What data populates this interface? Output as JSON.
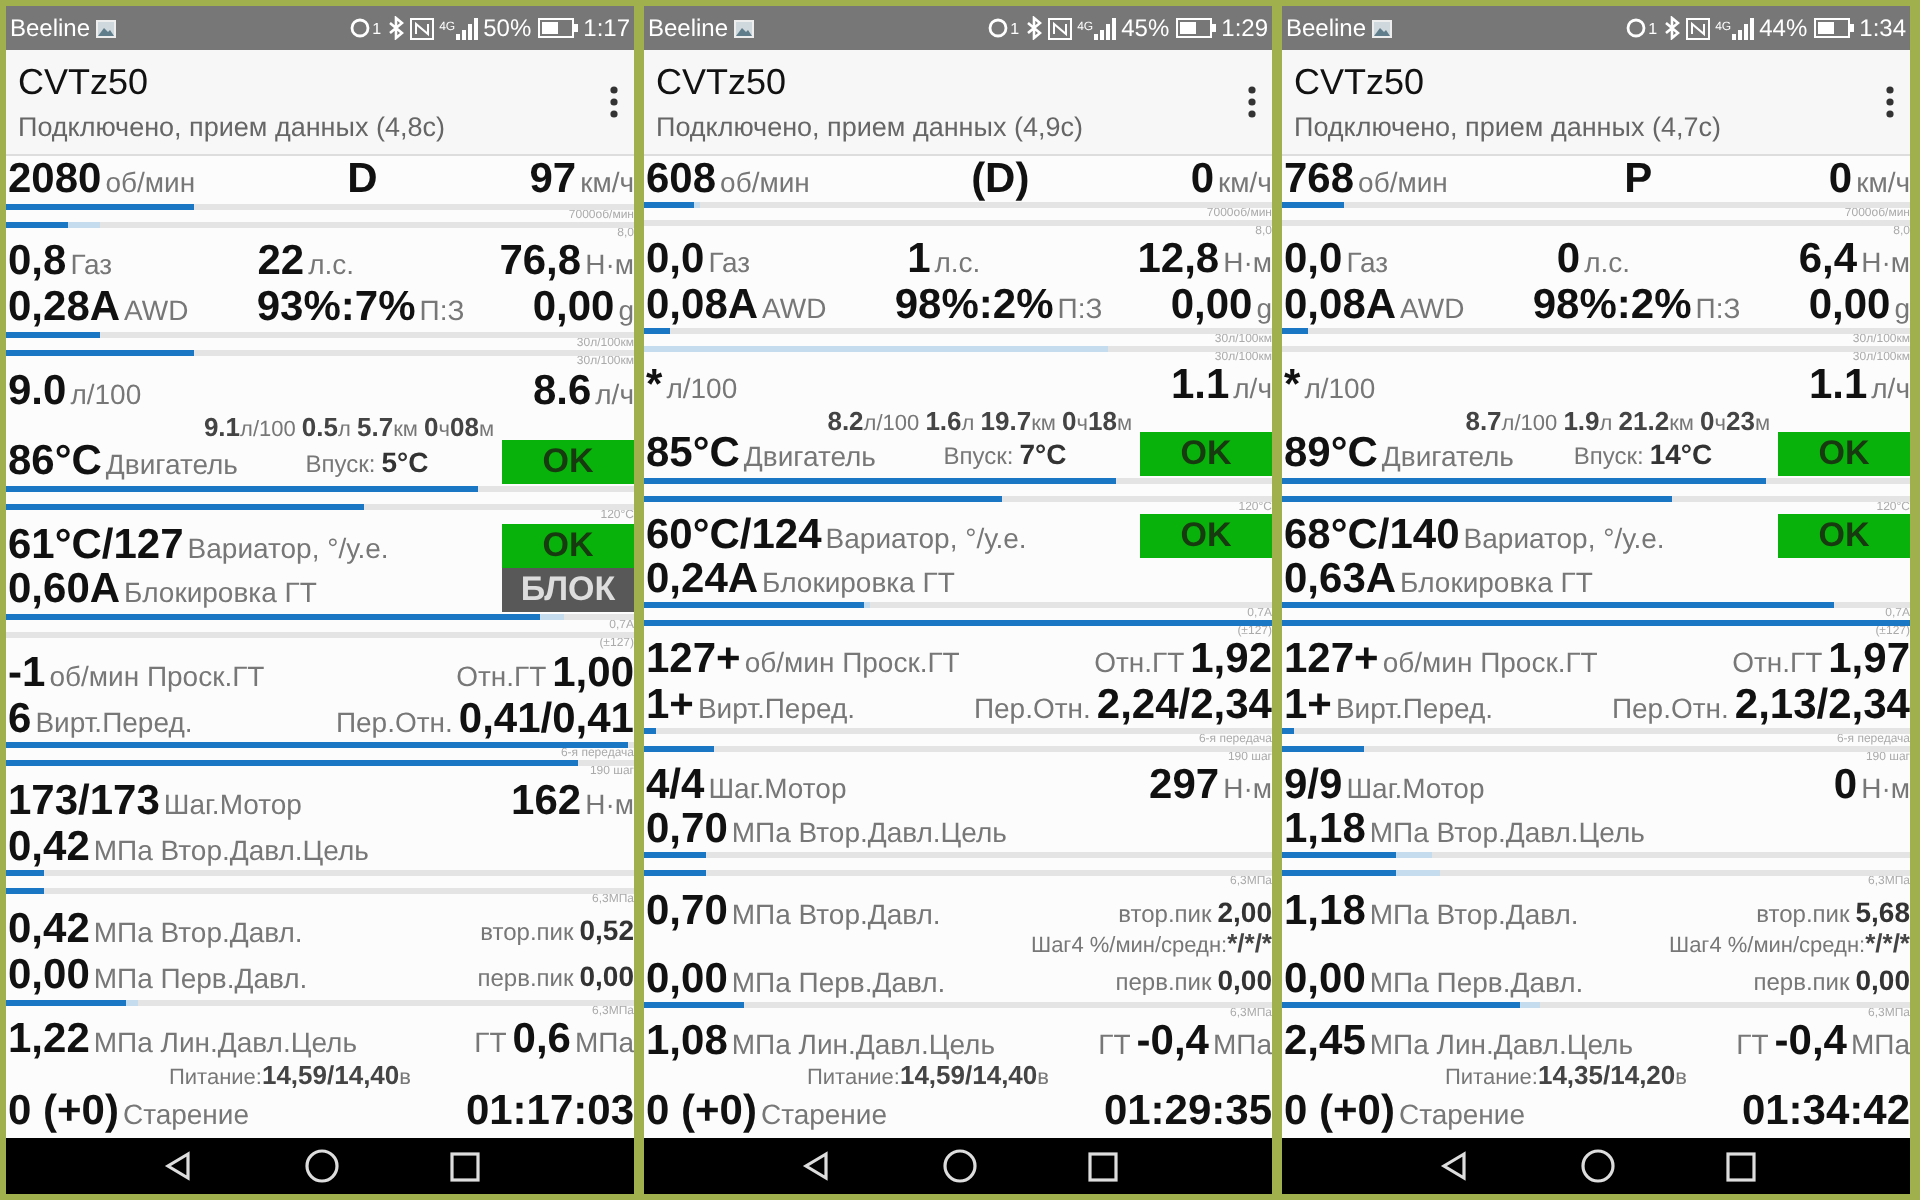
{
  "panels": [
    {
      "status_bar": {
        "carrier": "Beeline",
        "sync_count": "1",
        "network": "4G",
        "battery": "50%",
        "time": "1:17"
      },
      "app_bar": {
        "title": "CVTz50",
        "subtitle": "Подключено, прием данных (4,8с)"
      },
      "lines": [
        {
          "kind": "readings",
          "left": {
            "value": "2080",
            "unit": "об/мин"
          },
          "center": {
            "value": "D"
          },
          "right": {
            "value": "97",
            "unit": "км/ч"
          }
        },
        {
          "kind": "gauges",
          "bars": [
            {
              "fills": [
                {
                  "kind": "live",
                  "level": 0.3
                }
              ],
              "scale": "7000об/мин"
            },
            {
              "fills": [
                {
                  "kind": "live",
                  "level": 0.1
                },
                {
                  "kind": "peak",
                  "level": 0.15
                }
              ],
              "scale": "8,0"
            }
          ]
        },
        {
          "kind": "readings",
          "left": {
            "value": "0,8",
            "unit": "Газ"
          },
          "center": {
            "value": "22",
            "unit": "л.с."
          },
          "right": {
            "value": "76,8",
            "unit": "Н·м"
          }
        },
        {
          "kind": "readings",
          "left": {
            "value": "0,28A",
            "unit": "AWD"
          },
          "center": {
            "value": "93%:7%",
            "unit": "П:З"
          },
          "right": {
            "value": "0,00",
            "unit": "g"
          }
        },
        {
          "kind": "gauges",
          "bars": [
            {
              "fills": [
                {
                  "kind": "live",
                  "level": 0.15
                }
              ],
              "scale": "30л/100км"
            },
            {
              "fills": [
                {
                  "kind": "live",
                  "level": 0.3
                }
              ],
              "scale": "30л/100км"
            }
          ]
        },
        {
          "kind": "readings",
          "left": {
            "value": "9.0",
            "unit": "л/100"
          },
          "right": {
            "value": "8.6",
            "unit": "л/ч"
          }
        },
        {
          "kind": "trip",
          "text": "**9.1**л/100 **0.5**л **5.7**км **0**ч**08**м"
        },
        {
          "kind": "readings",
          "left": {
            "value": "86°C",
            "unit": "Двигатель"
          },
          "right": {
            "kind": "minor",
            "label": "Впуск:",
            "value": "5°C"
          },
          "badge": {
            "kind": "ok",
            "text": "OK"
          }
        },
        {
          "kind": "gauges",
          "bars": [
            {
              "fills": [
                {
                  "kind": "live",
                  "level": 0.75
                }
              ]
            },
            {
              "fills": [
                {
                  "kind": "live",
                  "level": 0.57
                }
              ],
              "scale": "120°C"
            }
          ]
        },
        {
          "kind": "readings",
          "left": {
            "value": "61°C/127",
            "unit": "Вариатор, °/у.е."
          },
          "badge": {
            "kind": "ok",
            "text": "OK"
          }
        },
        {
          "kind": "readings",
          "left": {
            "value": "0,60A",
            "unit": "Блокировка ГТ"
          },
          "badge": {
            "kind": "lock",
            "text": "БЛОК"
          }
        },
        {
          "kind": "gauges",
          "bars": [
            {
              "fills": [
                {
                  "kind": "live",
                  "level": 0.85
                },
                {
                  "kind": "peak",
                  "level": 0.89
                }
              ],
              "scale": "0,7A"
            },
            {
              "scale": "(±127)"
            }
          ]
        },
        {
          "kind": "readings",
          "left": {
            "value": "-1",
            "unit": "об/мин Проск.ГТ"
          },
          "right": {
            "label": "Отн.ГТ",
            "value": "1,00"
          }
        },
        {
          "kind": "readings",
          "left": {
            "value": "6",
            "unit": "Вирт.Перед."
          },
          "right": {
            "label": "Пер.Отн.",
            "value": "0,41/0,41"
          }
        },
        {
          "kind": "gauges",
          "bars": [
            {
              "fills": [
                {
                  "kind": "live",
                  "level": 0.99
                }
              ],
              "scale": "6-я передача"
            },
            {
              "fills": [
                {
                  "kind": "live",
                  "level": 0.91
                }
              ],
              "scale": "190 шаг"
            }
          ]
        },
        {
          "kind": "readings",
          "left": {
            "value": "173/173",
            "unit": "Шаг.Мотор"
          },
          "right": {
            "value": "162",
            "unit": "Н·м"
          }
        },
        {
          "kind": "readings",
          "left": {
            "value": "0,42",
            "unit": "МПа Втор.Давл.Цель"
          }
        },
        {
          "kind": "gauges",
          "bars": [
            {
              "fills": [
                {
                  "kind": "live",
                  "level": 0.06
                }
              ]
            },
            {
              "fills": [
                {
                  "kind": "live",
                  "level": 0.06
                }
              ],
              "scale": "6,3МПа"
            }
          ]
        },
        {
          "kind": "readings",
          "left": {
            "value": "0,42",
            "unit": "МПа Втор.Давл."
          },
          "right": {
            "kind": "minor",
            "label": "втор.пик",
            "value": "0,52"
          }
        },
        {
          "kind": "readings",
          "left": {
            "value": "0,00",
            "unit": "МПа Перв.Давл."
          },
          "right": {
            "kind": "minor",
            "label": "перв.пик",
            "value": "0,00"
          }
        },
        {
          "kind": "gauges",
          "bars": [
            {
              "fills": [
                {
                  "kind": "live",
                  "level": 0.19
                },
                {
                  "kind": "peak",
                  "level": 0.21
                }
              ],
              "scale": "6,3МПа"
            }
          ]
        },
        {
          "kind": "readings",
          "left": {
            "value": "1,22",
            "unit": "МПа Лин.Давл.Цель"
          },
          "right": {
            "label": "ГТ",
            "value": "0,6",
            "unit": "МПа"
          }
        },
        {
          "kind": "supply",
          "label": "Питание:",
          "value": "14,59/14,40",
          "unit": "в"
        },
        {
          "kind": "readings",
          "left": {
            "value": "0 (+0)",
            "unit": "Старение"
          },
          "right": {
            "value": "01:17:03"
          }
        }
      ]
    },
    {
      "status_bar": {
        "carrier": "Beeline",
        "sync_count": "1",
        "network": "4G",
        "battery": "45%",
        "time": "1:29"
      },
      "app_bar": {
        "title": "CVTz50",
        "subtitle": "Подключено, прием данных (4,9с)"
      },
      "lines": [
        {
          "kind": "readings",
          "left": {
            "value": "608",
            "unit": "об/мин"
          },
          "center": {
            "value": "(D)"
          },
          "right": {
            "value": "0",
            "unit": "км/ч"
          }
        },
        {
          "kind": "gauges",
          "bars": [
            {
              "fills": [
                {
                  "kind": "live",
                  "level": 0.08
                },
                {
                  "kind": "peak",
                  "level": 0.09
                }
              ],
              "scale": "7000об/мин"
            },
            {
              "scale": "8,0"
            }
          ]
        },
        {
          "kind": "readings",
          "left": {
            "value": "0,0",
            "unit": "Газ"
          },
          "center": {
            "value": "1",
            "unit": "л.с."
          },
          "right": {
            "value": "12,8",
            "unit": "Н·м"
          }
        },
        {
          "kind": "readings",
          "left": {
            "value": "0,08A",
            "unit": "AWD"
          },
          "center": {
            "value": "98%:2%",
            "unit": "П:З"
          },
          "right": {
            "value": "0,00",
            "unit": "g"
          }
        },
        {
          "kind": "gauges",
          "bars": [
            {
              "fills": [
                {
                  "kind": "live",
                  "level": 0.04
                }
              ],
              "scale": "30л/100км"
            },
            {
              "fills": [
                {
                  "kind": "peak",
                  "level": 0.74
                }
              ],
              "scale": "30л/100км"
            }
          ]
        },
        {
          "kind": "readings",
          "left": {
            "value": "*",
            "unit": "л/100"
          },
          "right": {
            "value": "1.1",
            "unit": "л/ч"
          }
        },
        {
          "kind": "trip",
          "text": "**8.2**л/100 **1.6**л **19.7**км **0**ч**18**м"
        },
        {
          "kind": "readings",
          "left": {
            "value": "85°C",
            "unit": "Двигатель"
          },
          "right": {
            "kind": "minor",
            "label": "Впуск:",
            "value": "7°C"
          },
          "badge": {
            "kind": "ok",
            "text": "OK"
          }
        },
        {
          "kind": "gauges",
          "bars": [
            {
              "fills": [
                {
                  "kind": "live",
                  "level": 0.75
                }
              ]
            },
            {
              "fills": [
                {
                  "kind": "live",
                  "level": 0.57
                }
              ],
              "scale": "120°C"
            }
          ]
        },
        {
          "kind": "readings",
          "left": {
            "value": "60°C/124",
            "unit": "Вариатор, °/у.е."
          },
          "badge": {
            "kind": "ok",
            "text": "OK"
          }
        },
        {
          "kind": "readings",
          "left": {
            "value": "0,24A",
            "unit": "Блокировка ГТ"
          }
        },
        {
          "kind": "gauges",
          "bars": [
            {
              "fills": [
                {
                  "kind": "live",
                  "level": 0.35
                },
                {
                  "kind": "peak",
                  "level": 0.36
                }
              ],
              "scale": "0,7A"
            },
            {
              "fills": [
                {
                  "kind": "live",
                  "level": 1
                }
              ],
              "scale": "(±127)"
            }
          ]
        },
        {
          "kind": "readings",
          "left": {
            "value": "127+",
            "unit": "об/мин Проск.ГТ"
          },
          "right": {
            "label": "Отн.ГТ",
            "value": "1,92"
          }
        },
        {
          "kind": "readings",
          "left": {
            "value": "1+",
            "unit": "Вирт.Перед."
          },
          "right": {
            "label": "Пер.Отн.",
            "value": "2,24/2,34"
          }
        },
        {
          "kind": "gauges",
          "bars": [
            {
              "fills": [
                {
                  "kind": "live",
                  "level": 0.02
                }
              ],
              "scale": "6-я передача"
            },
            {
              "fills": [
                {
                  "kind": "live",
                  "level": 0.11
                }
              ],
              "scale": "190 шаг"
            }
          ]
        },
        {
          "kind": "readings",
          "left": {
            "value": "4/4",
            "unit": "Шаг.Мотор"
          },
          "right": {
            "value": "297",
            "unit": "Н·м"
          }
        },
        {
          "kind": "readings",
          "left": {
            "value": "0,70",
            "unit": "МПа Втор.Давл.Цель"
          }
        },
        {
          "kind": "gauges",
          "bars": [
            {
              "fills": [
                {
                  "kind": "live",
                  "level": 0.1
                }
              ]
            },
            {
              "fills": [
                {
                  "kind": "live",
                  "level": 0.1
                }
              ],
              "scale": "6,3МПа"
            }
          ]
        },
        {
          "kind": "readings",
          "left": {
            "value": "0,70",
            "unit": "МПа Втор.Давл."
          },
          "right": {
            "kind": "minor",
            "label": "втор.пик",
            "value": "2,00"
          }
        },
        {
          "kind": "step",
          "label": "Шаг4 %/мин/средн:",
          "value": "*/*/*"
        },
        {
          "kind": "readings",
          "left": {
            "value": "0,00",
            "unit": "МПа Перв.Давл."
          },
          "right": {
            "kind": "minor",
            "label": "перв.пик",
            "value": "0,00"
          }
        },
        {
          "kind": "gauges",
          "bars": [
            {
              "fills": [
                {
                  "kind": "live",
                  "level": 0.16
                }
              ],
              "scale": "6,3МПа"
            }
          ]
        },
        {
          "kind": "readings",
          "left": {
            "value": "1,08",
            "unit": "МПа Лин.Давл.Цель"
          },
          "right": {
            "label": "ГТ",
            "value": "-0,4",
            "unit": "МПа"
          }
        },
        {
          "kind": "supply",
          "label": "Питание:",
          "value": "14,59/14,40",
          "unit": "в"
        },
        {
          "kind": "readings",
          "left": {
            "value": "0 (+0)",
            "unit": "Старение"
          },
          "right": {
            "value": "01:29:35"
          }
        }
      ]
    },
    {
      "status_bar": {
        "carrier": "Beeline",
        "sync_count": "1",
        "network": "4G",
        "battery": "44%",
        "time": "1:34"
      },
      "app_bar": {
        "title": "CVTz50",
        "subtitle": "Подключено, прием данных (4,7с)"
      },
      "lines": [
        {
          "kind": "readings",
          "left": {
            "value": "768",
            "unit": "об/мин"
          },
          "center": {
            "value": "P"
          },
          "right": {
            "value": "0",
            "unit": "км/ч"
          }
        },
        {
          "kind": "gauges",
          "bars": [
            {
              "fills": [
                {
                  "kind": "live",
                  "level": 0.1
                }
              ],
              "scale": "7000об/мин"
            },
            {
              "scale": "8,0"
            }
          ]
        },
        {
          "kind": "readings",
          "left": {
            "value": "0,0",
            "unit": "Газ"
          },
          "center": {
            "value": "0",
            "unit": "л.с."
          },
          "right": {
            "value": "6,4",
            "unit": "Н·м"
          }
        },
        {
          "kind": "readings",
          "left": {
            "value": "0,08A",
            "unit": "AWD"
          },
          "center": {
            "value": "98%:2%",
            "unit": "П:З"
          },
          "right": {
            "value": "0,00",
            "unit": "g"
          }
        },
        {
          "kind": "gauges",
          "bars": [
            {
              "fills": [
                {
                  "kind": "live",
                  "level": 0.04
                }
              ],
              "scale": "30л/100км"
            },
            {
              "scale": "30л/100км"
            }
          ]
        },
        {
          "kind": "readings",
          "left": {
            "value": "*",
            "unit": "л/100"
          },
          "right": {
            "value": "1.1",
            "unit": "л/ч"
          }
        },
        {
          "kind": "trip",
          "text": "**8.7**л/100 **1.9**л **21.2**км **0**ч**23**м"
        },
        {
          "kind": "readings",
          "left": {
            "value": "89°C",
            "unit": "Двигатель"
          },
          "right": {
            "kind": "minor",
            "label": "Впуск:",
            "value": "14°C"
          },
          "badge": {
            "kind": "ok",
            "text": "OK"
          }
        },
        {
          "kind": "gauges",
          "bars": [
            {
              "fills": [
                {
                  "kind": "live",
                  "level": 0.77
                }
              ]
            },
            {
              "fills": [
                {
                  "kind": "live",
                  "level": 0.62
                }
              ],
              "scale": "120°C"
            }
          ]
        },
        {
          "kind": "readings",
          "left": {
            "value": "68°C/140",
            "unit": "Вариатор, °/у.е."
          },
          "badge": {
            "kind": "ok",
            "text": "OK"
          }
        },
        {
          "kind": "readings",
          "left": {
            "value": "0,63A",
            "unit": "Блокировка ГТ"
          }
        },
        {
          "kind": "gauges",
          "bars": [
            {
              "fills": [
                {
                  "kind": "live",
                  "level": 0.88
                }
              ],
              "scale": "0,7A"
            },
            {
              "fills": [
                {
                  "kind": "live",
                  "level": 1
                }
              ],
              "scale": "(±127)"
            }
          ]
        },
        {
          "kind": "readings",
          "left": {
            "value": "127+",
            "unit": "об/мин Проск.ГТ"
          },
          "right": {
            "label": "Отн.ГТ",
            "value": "1,97"
          }
        },
        {
          "kind": "readings",
          "left": {
            "value": "1+",
            "unit": "Вирт.Перед."
          },
          "right": {
            "label": "Пер.Отн.",
            "value": "2,13/2,34"
          }
        },
        {
          "kind": "gauges",
          "bars": [
            {
              "fills": [
                {
                  "kind": "live",
                  "level": 0.02
                }
              ],
              "scale": "6-я передача"
            },
            {
              "fills": [
                {
                  "kind": "live",
                  "level": 0.13
                }
              ],
              "scale": "190 шаг"
            }
          ]
        },
        {
          "kind": "readings",
          "left": {
            "value": "9/9",
            "unit": "Шаг.Мотор"
          },
          "right": {
            "value": "0",
            "unit": "Н·м"
          }
        },
        {
          "kind": "readings",
          "left": {
            "value": "1,18",
            "unit": "МПа Втор.Давл.Цель"
          }
        },
        {
          "kind": "gauges",
          "bars": [
            {
              "fills": [
                {
                  "kind": "live",
                  "level": 0.18
                },
                {
                  "kind": "peak",
                  "level": 0.24
                }
              ]
            },
            {
              "fills": [
                {
                  "kind": "live",
                  "level": 0.18
                },
                {
                  "kind": "peak",
                  "level": 0.25
                }
              ],
              "scale": "6,3МПа"
            }
          ]
        },
        {
          "kind": "readings",
          "left": {
            "value": "1,18",
            "unit": "МПа Втор.Давл."
          },
          "right": {
            "kind": "minor",
            "label": "втор.пик",
            "value": "5,68"
          }
        },
        {
          "kind": "step",
          "label": "Шаг4 %/мин/средн:",
          "value": "*/*/*"
        },
        {
          "kind": "readings",
          "left": {
            "value": "0,00",
            "unit": "МПа Перв.Давл."
          },
          "right": {
            "kind": "minor",
            "label": "перв.пик",
            "value": "0,00"
          }
        },
        {
          "kind": "gauges",
          "bars": [
            {
              "fills": [
                {
                  "kind": "live",
                  "level": 0.38
                },
                {
                  "kind": "peak",
                  "level": 0.41
                }
              ],
              "scale": "6,3МПа"
            }
          ]
        },
        {
          "kind": "readings",
          "left": {
            "value": "2,45",
            "unit": "МПа Лин.Давл.Цель"
          },
          "right": {
            "label": "ГТ",
            "value": "-0,4",
            "unit": "МПа"
          }
        },
        {
          "kind": "supply",
          "label": "Питание:",
          "value": "14,35/14,20",
          "unit": "в"
        },
        {
          "kind": "readings",
          "left": {
            "value": "0 (+0)",
            "unit": "Старение"
          },
          "right": {
            "value": "01:34:42"
          }
        }
      ]
    }
  ]
}
